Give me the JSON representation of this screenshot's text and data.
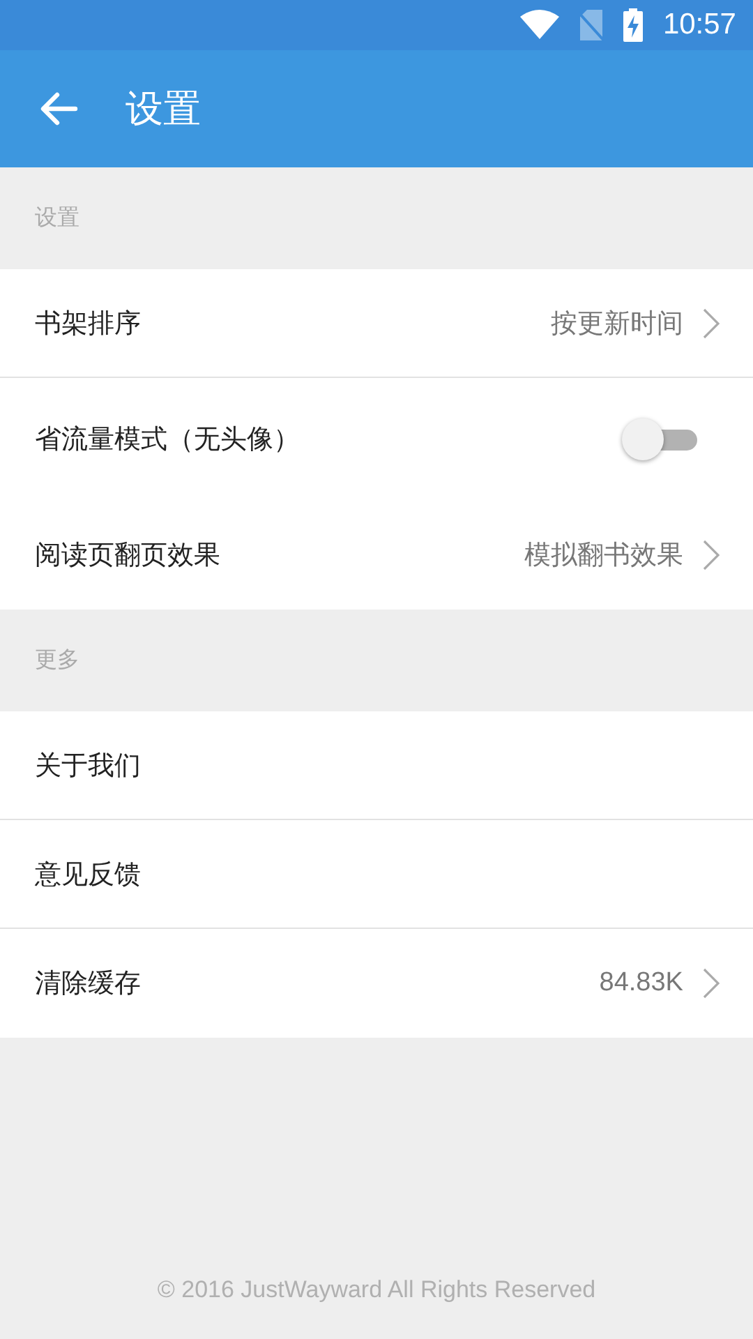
{
  "status_bar": {
    "time": "10:57"
  },
  "toolbar": {
    "title": "设置"
  },
  "sections": [
    {
      "header": "设置",
      "items": [
        {
          "kind": "value",
          "label": "书架排序",
          "value": "按更新时间",
          "divider": true
        },
        {
          "kind": "toggle",
          "label": "省流量模式（无头像）",
          "on": false,
          "divider": false
        },
        {
          "kind": "value",
          "label": "阅读页翻页效果",
          "value": "模拟翻书效果",
          "divider": false
        }
      ]
    },
    {
      "header": "更多",
      "items": [
        {
          "kind": "plain",
          "label": "关于我们",
          "divider": true
        },
        {
          "kind": "plain",
          "label": "意见反馈",
          "divider": true
        },
        {
          "kind": "value",
          "label": "清除缓存",
          "value": "84.83K",
          "divider": false
        }
      ]
    }
  ],
  "footer": "© 2016 JustWayward All Rights Reserved"
}
